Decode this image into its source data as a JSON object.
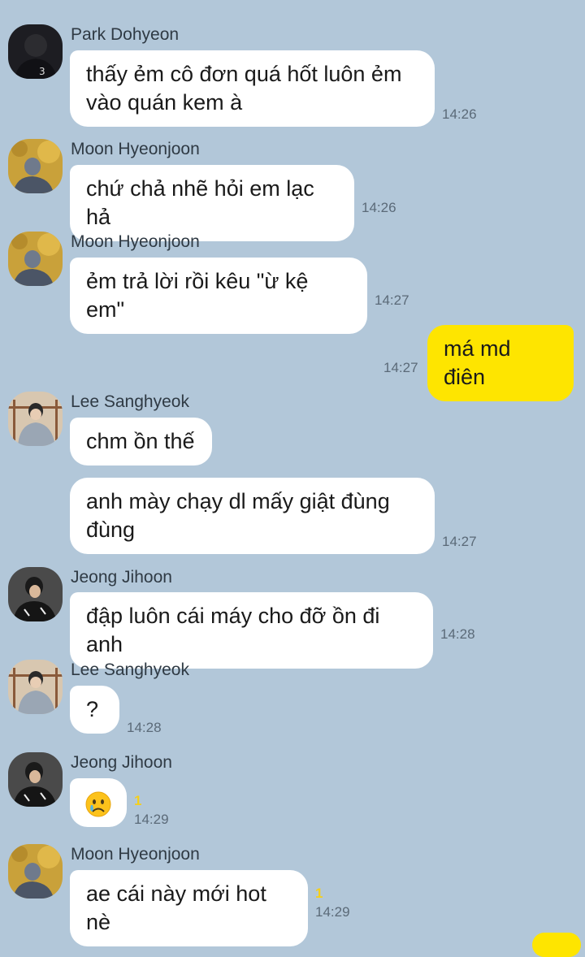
{
  "messages": [
    {
      "sender": "Park Dohyeon",
      "lines": [
        "thấy ẻm cô đơn quá hốt luôn ẻm",
        "vào quán kem à"
      ],
      "time": "14:26"
    },
    {
      "sender": "Moon Hyeonjoon",
      "lines": [
        "chứ chả nhẽ hỏi em lạc hả"
      ],
      "time": "14:26"
    },
    {
      "sender": "Moon Hyeonjoon",
      "lines": [
        "ẻm trả lời rồi kêu \"ừ kệ em\""
      ],
      "time": "14:27"
    },
    {
      "sender": "me",
      "lines": [
        "má md điên"
      ],
      "time": "14:27"
    },
    {
      "sender": "Lee Sanghyeok",
      "lines": [
        "chm ồn thế"
      ],
      "time": ""
    },
    {
      "sender": "Lee Sanghyeok",
      "lines": [
        "anh mày chạy dl mấy giật đùng",
        "đùng"
      ],
      "time": "14:27"
    },
    {
      "sender": "Jeong Jihoon",
      "lines": [
        "đập luôn cái máy cho đỡ ồn đi anh"
      ],
      "time": "14:28"
    },
    {
      "sender": "Lee Sanghyeok",
      "lines": [
        "?"
      ],
      "time": "14:28"
    },
    {
      "sender": "Jeong Jihoon",
      "emoji": "worried-face",
      "time": "14:29",
      "unread": "1"
    },
    {
      "sender": "Moon Hyeonjoon",
      "lines": [
        "ae cái này mới hot nè"
      ],
      "time": "14:29",
      "unread": "1"
    }
  ],
  "colors": {
    "background": "#b2c7d9",
    "my_bubble": "#fee500",
    "their_bubble": "#ffffff",
    "unread": "#f5cf1a"
  }
}
